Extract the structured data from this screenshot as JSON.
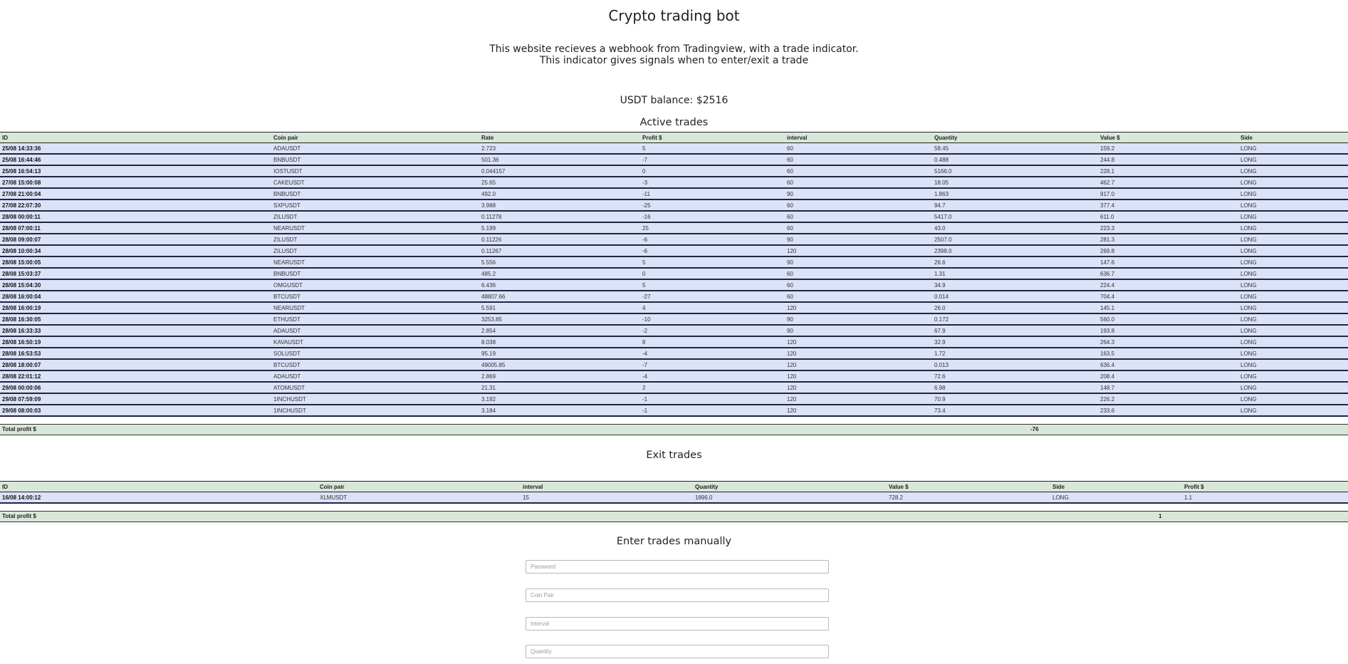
{
  "header": {
    "title": "Crypto trading bot",
    "desc_line1": "This website recieves a webhook from Tradingview, with a trade indicator.",
    "desc_line2": "This indicator gives signals when to enter/exit a trade",
    "balance": "USDT balance: $2516"
  },
  "active": {
    "title": "Active trades",
    "columns": [
      "ID",
      "Coin pair",
      "Rate",
      "Profit $",
      "interval",
      "Quantity",
      "Value $",
      "Side"
    ],
    "rows": [
      [
        "25/08 14:33:36",
        "ADAUSDT",
        "2.723",
        "5",
        "60",
        "58.45",
        "159.2",
        "LONG"
      ],
      [
        "25/08 16:44:46",
        "BNBUSDT",
        "501.36",
        "-7",
        "60",
        "0.488",
        "244.8",
        "LONG"
      ],
      [
        "25/08 16:54:13",
        "IOSTUSDT",
        "0.044157",
        "0",
        "60",
        "5166.0",
        "228.1",
        "LONG"
      ],
      [
        "27/08 15:00:08",
        "CAKEUSDT",
        "25.65",
        "-3",
        "60",
        "18.05",
        "462.7",
        "LONG"
      ],
      [
        "27/08 21:00:04",
        "BNBUSDT",
        "492.0",
        "-11",
        "90",
        "1.863",
        "917.0",
        "LONG"
      ],
      [
        "27/08 22:07:30",
        "SXPUSDT",
        "3.988",
        "-25",
        "60",
        "94.7",
        "377.4",
        "LONG"
      ],
      [
        "28/08 00:00:11",
        "ZILUSDT",
        "0.11278",
        "-16",
        "60",
        "5417.0",
        "611.0",
        "LONG"
      ],
      [
        "28/08 07:00:11",
        "NEARUSDT",
        "5.199",
        "25",
        "60",
        "43.0",
        "223.3",
        "LONG"
      ],
      [
        "28/08 09:00:07",
        "ZILUSDT",
        "0.11226",
        "-6",
        "90",
        "2507.0",
        "281.3",
        "LONG"
      ],
      [
        "28/08 10:00:34",
        "ZILUSDT",
        "0.11267",
        "-6",
        "120",
        "2398.0",
        "269.8",
        "LONG"
      ],
      [
        "28/08 15:00:05",
        "NEARUSDT",
        "5.556",
        "5",
        "90",
        "26.6",
        "147.6",
        "LONG"
      ],
      [
        "28/08 15:03:37",
        "BNBUSDT",
        "485.2",
        "0",
        "60",
        "1.31",
        "636.7",
        "LONG"
      ],
      [
        "28/08 15:04:30",
        "OMGUSDT",
        "6.436",
        "5",
        "60",
        "34.9",
        "224.4",
        "LONG"
      ],
      [
        "28/08 16:00:04",
        "BTCUSDT",
        "48807.66",
        "-27",
        "60",
        "0.014",
        "704.4",
        "LONG"
      ],
      [
        "28/08 16:00:19",
        "NEARUSDT",
        "5.591",
        "4",
        "120",
        "26.0",
        "145.1",
        "LONG"
      ],
      [
        "28/08 16:30:05",
        "ETHUSDT",
        "3253.85",
        "-10",
        "90",
        "0.172",
        "560.0",
        "LONG"
      ],
      [
        "28/08 16:33:33",
        "ADAUSDT",
        "2.854",
        "-2",
        "90",
        "67.9",
        "193.8",
        "LONG"
      ],
      [
        "28/08 16:50:19",
        "KAVAUSDT",
        "8.038",
        "8",
        "120",
        "32.9",
        "264.3",
        "LONG"
      ],
      [
        "28/08 16:53:53",
        "SOLUSDT",
        "95.19",
        "-4",
        "120",
        "1.72",
        "163.5",
        "LONG"
      ],
      [
        "28/08 18:00:07",
        "BTCUSDT",
        "49005.85",
        "-7",
        "120",
        "0.013",
        "636.4",
        "LONG"
      ],
      [
        "28/08 22:01:12",
        "ADAUSDT",
        "2.869",
        "-4",
        "120",
        "72.6",
        "208.4",
        "LONG"
      ],
      [
        "29/08 00:00:06",
        "ATOMUSDT",
        "21.31",
        "2",
        "120",
        "6.98",
        "148.7",
        "LONG"
      ],
      [
        "29/08 07:59:09",
        "1INCHUSDT",
        "3.192",
        "-1",
        "120",
        "70.9",
        "226.2",
        "LONG"
      ],
      [
        "29/08 08:00:03",
        "1INCHUSDT",
        "3.184",
        "-1",
        "120",
        "73.4",
        "233.6",
        "LONG"
      ]
    ],
    "total_label": "Total profit $",
    "total_value": "-76"
  },
  "exit": {
    "title": "Exit trades",
    "columns": [
      "ID",
      "Coin pair",
      "interval",
      "Quantity",
      "Value $",
      "Side",
      "Profit $"
    ],
    "rows": [
      [
        "16/08 14:00:12",
        "XLMUSDT",
        "15",
        "1896.0",
        "728.2",
        "LONG",
        "1.1"
      ]
    ],
    "total_label": "Total profit $",
    "total_value": "1"
  },
  "manual": {
    "title": "Enter trades manually",
    "password_placeholder": "Password",
    "coinpair_placeholder": "Coin Pair",
    "interval_placeholder": "Interval",
    "quantity_placeholder": "Quantity"
  }
}
